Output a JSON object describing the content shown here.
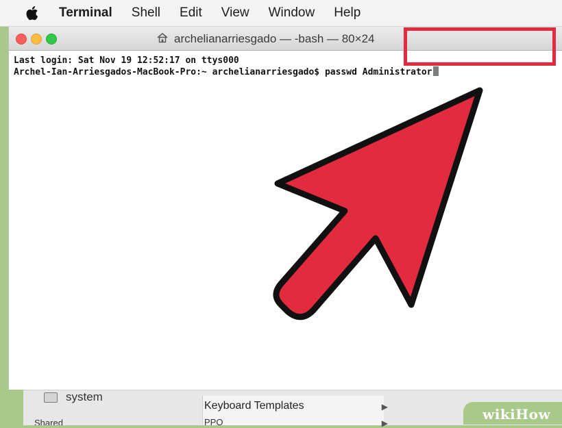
{
  "menubar": {
    "apple_icon": "apple-icon",
    "items": [
      "Terminal",
      "Shell",
      "Edit",
      "View",
      "Window",
      "Help"
    ]
  },
  "window": {
    "title": "archelianarriesgado — -bash — 80×24",
    "title_icon": "home-icon"
  },
  "terminal": {
    "line1": "Last login: Sat Nov 19 12:52:17 on ttys000",
    "prompt": "Archel-Ian-Arriesgados-MacBook-Pro:~ archelianarriesgado$ ",
    "command": "passwd Administrator"
  },
  "bottom": {
    "system_label": "system",
    "menu_item": "Keyboard Templates",
    "menu_item2": "PPO",
    "cut_text": "Shared"
  },
  "watermark": {
    "part1": "wiki",
    "part2": "How"
  },
  "colors": {
    "arrow": "#e32b3f",
    "highlight": "#e32b3f",
    "background": "#a9c98a"
  }
}
